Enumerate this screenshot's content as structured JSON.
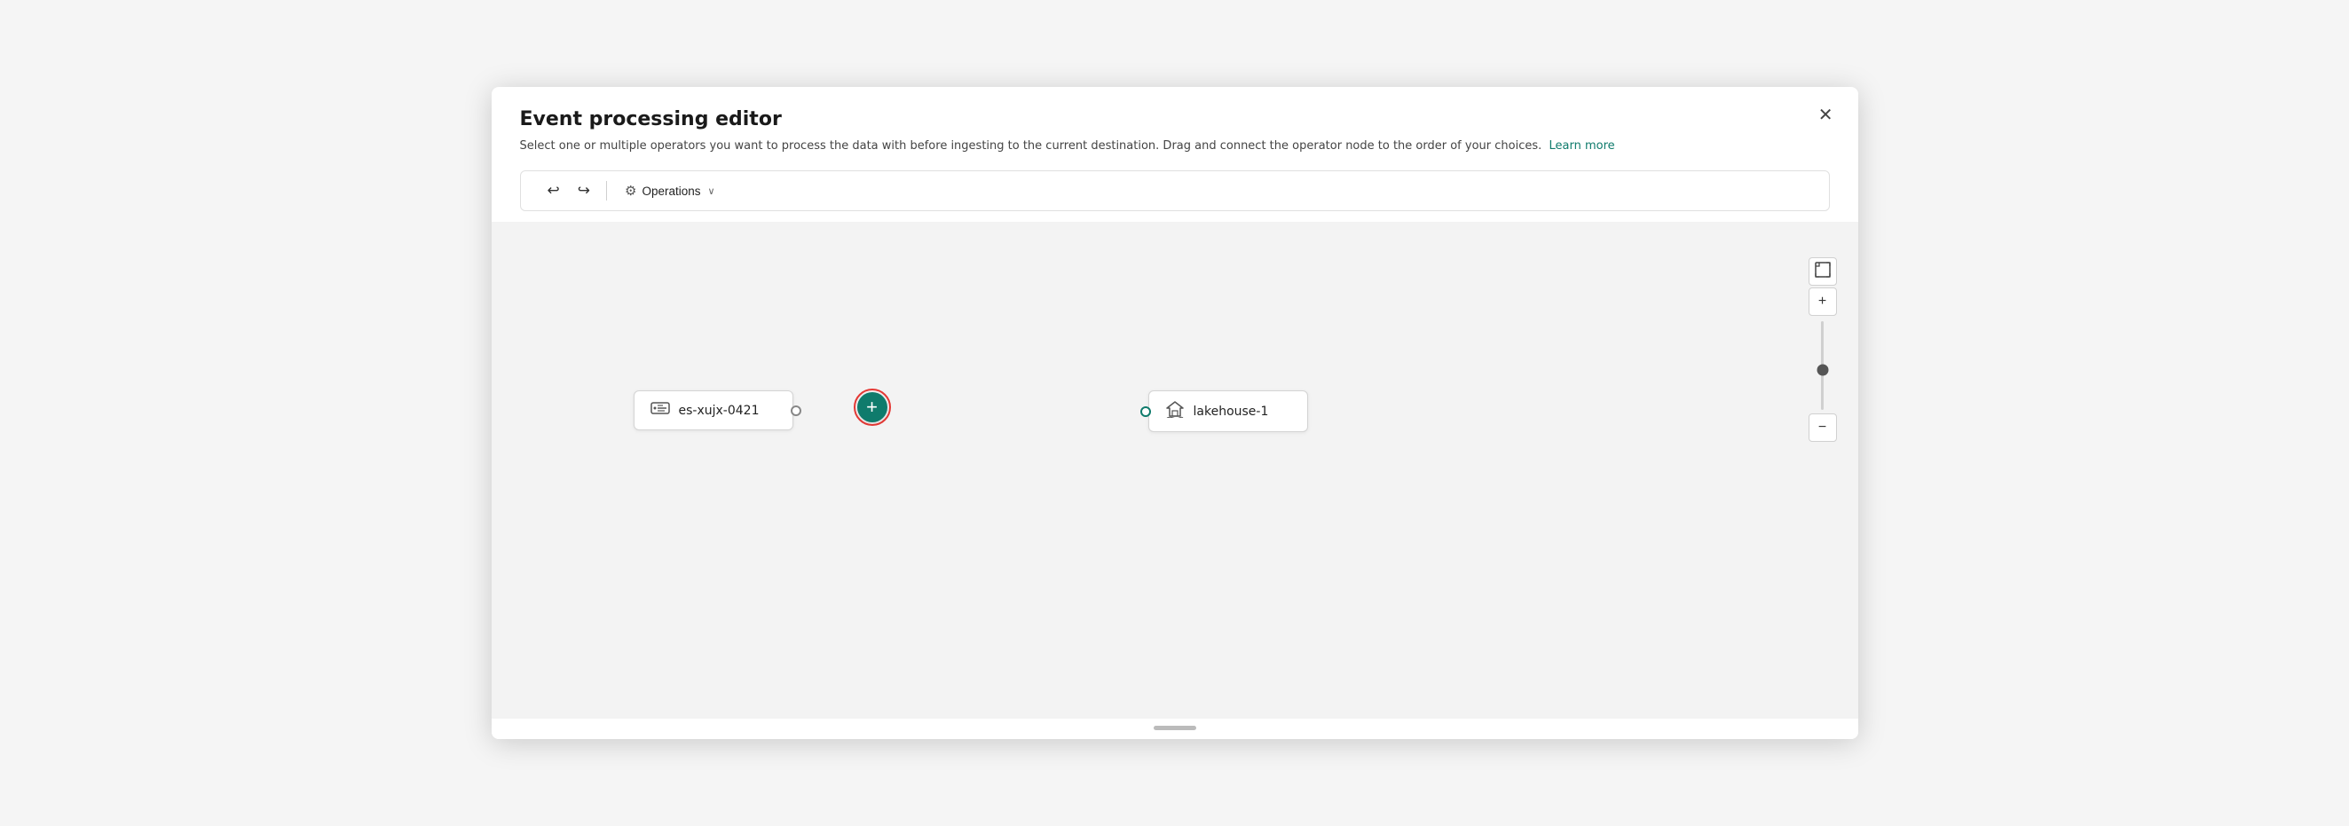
{
  "dialog": {
    "title": "Event processing editor",
    "subtitle": "Select one or multiple operators you want to process the data with before ingesting to the current destination. Drag and connect the operator node to the order of your choices.",
    "learn_more_label": "Learn more",
    "close_label": "✕"
  },
  "toolbar": {
    "undo_label": "↩",
    "redo_label": "↪",
    "operations_label": "Operations",
    "operations_chevron": "∨",
    "operations_icon": "⚙"
  },
  "canvas": {
    "source_node_label": "es-xujx-0421",
    "destination_node_label": "lakehouse-1",
    "add_operation_label": "+"
  },
  "zoom": {
    "fit_icon": "⛶",
    "plus_icon": "+",
    "minus_icon": "−"
  },
  "colors": {
    "accent": "#0f7b6c",
    "highlight_border": "#e53935"
  }
}
